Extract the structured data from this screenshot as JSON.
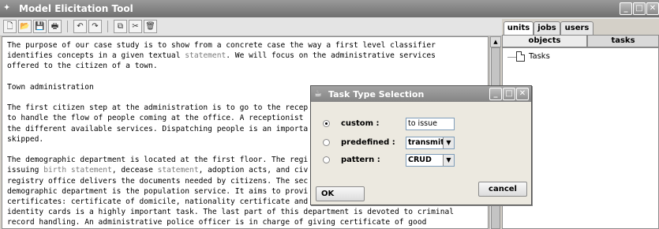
{
  "window": {
    "title": "Model Elicitation Tool"
  },
  "toolbar": {
    "buttons": [
      {
        "name": "new-icon",
        "glyph": "🗋"
      },
      {
        "name": "open-icon",
        "glyph": "📂"
      },
      {
        "name": "save-icon",
        "glyph": "💾"
      },
      {
        "name": "print-icon",
        "glyph": "🖶"
      },
      {
        "name": "undo-icon",
        "glyph": "↶"
      },
      {
        "name": "redo-icon",
        "glyph": "↷"
      },
      {
        "name": "copy-icon",
        "glyph": "⧉"
      },
      {
        "name": "cut-icon",
        "glyph": "✂"
      },
      {
        "name": "delete-icon",
        "glyph": "🗑"
      }
    ]
  },
  "document": {
    "lines": [
      [
        {
          "t": "The purpose of our case study is to show from a concrete case the way a first level classifier"
        }
      ],
      [
        {
          "t": "identifies concepts in a given textual "
        },
        {
          "t": "statement",
          "hl": true
        },
        {
          "t": ". We will focus on the administrative services"
        }
      ],
      [
        {
          "t": "offered to the citizen of a town."
        }
      ],
      [
        {
          "t": ""
        }
      ],
      [
        {
          "t": "Town administration"
        }
      ],
      [
        {
          "t": ""
        }
      ],
      [
        {
          "t": "The first citizen step at the administration is to go to the recep"
        }
      ],
      [
        {
          "t": "to handle the flow of people coming at the office. A receptionist"
        }
      ],
      [
        {
          "t": "the different available services. Dispatching people is an importa"
        }
      ],
      [
        {
          "t": "skipped."
        }
      ],
      [
        {
          "t": ""
        }
      ],
      [
        {
          "t": "The demographic department is located at the first floor. The regi"
        }
      ],
      [
        {
          "t": "issuing "
        },
        {
          "t": "birth statement",
          "hl": true
        },
        {
          "t": ", decease "
        },
        {
          "t": "statement",
          "hl": true
        },
        {
          "t": ", adoption acts, and civ"
        }
      ],
      [
        {
          "t": "registry office delivers the documents needed by citizens. The sec"
        }
      ],
      [
        {
          "t": "demographic department is the population service. It aims to provi"
        }
      ],
      [
        {
          "t": "certificates: certificate of domicile, nationality certificate and"
        }
      ],
      [
        {
          "t": "identity cards is a highly important task. The last part of this department is devoted to criminal"
        }
      ],
      [
        {
          "t": "record handling. An administrative police officer is in charge of giving certificate of good"
        }
      ]
    ]
  },
  "right_panel": {
    "tabs": [
      "units",
      "jobs",
      "users"
    ],
    "active_tab": "units",
    "subtabs": [
      "objects",
      "tasks"
    ],
    "active_subtab": "tasks",
    "tree": {
      "root_label": "Tasks"
    }
  },
  "dialog": {
    "title": "Task Type Selection",
    "options": [
      {
        "label": "custom :",
        "selected": true,
        "control": "text",
        "value": "to issue"
      },
      {
        "label": "predefined :",
        "selected": false,
        "control": "select",
        "value": "transmit"
      },
      {
        "label": "pattern :",
        "selected": false,
        "control": "select",
        "value": "CRUD"
      }
    ],
    "ok_label": "OK",
    "cancel_label": "cancel"
  }
}
